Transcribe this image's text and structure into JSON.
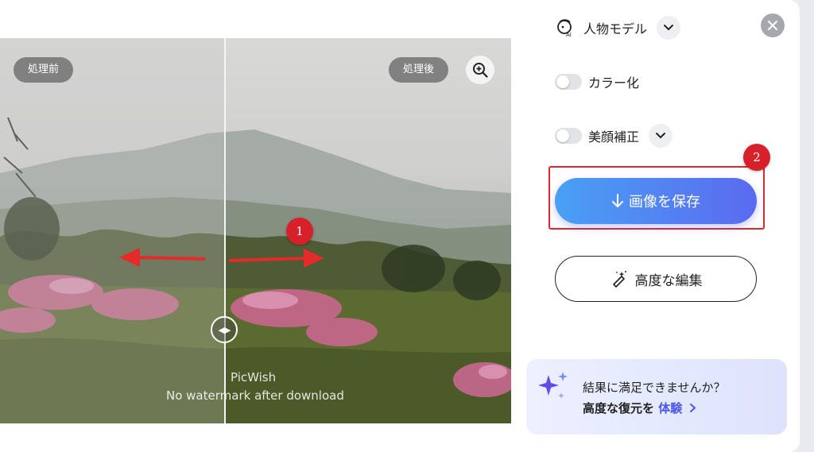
{
  "preview": {
    "before_label": "処理前",
    "after_label": "処理後",
    "watermark_brand": "PicWish",
    "watermark_note": "No watermark after download"
  },
  "settings": {
    "model_label": "人物モデル",
    "colorize_label": "カラー化",
    "beauty_label": "美顔補正",
    "colorize_on": false,
    "beauty_on": false
  },
  "actions": {
    "save_label": "画像を保存",
    "advanced_edit_label": "高度な編集"
  },
  "promo": {
    "line1": "結果に満足できませんか？",
    "line2": "高度な復元を",
    "try_label": "体験"
  },
  "annotations": {
    "step1": "1",
    "step2": "2"
  },
  "colors": {
    "accent": "#5b6af0",
    "annotation": "#d8202a"
  }
}
